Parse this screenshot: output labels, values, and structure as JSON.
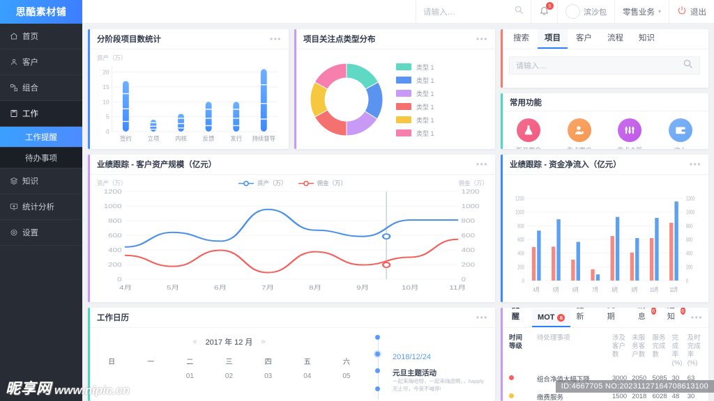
{
  "app": {
    "brand": "思酷素材铺"
  },
  "sidebar": {
    "items": [
      {
        "label": "首页",
        "icon": "home-icon"
      },
      {
        "label": "客户",
        "icon": "user-icon"
      },
      {
        "label": "组合",
        "icon": "portfolio-icon"
      },
      {
        "label": "工作",
        "icon": "briefcase-icon"
      }
    ],
    "sub_items": [
      {
        "label": "工作提醒",
        "active": true
      },
      {
        "label": "待办事项",
        "active": false
      }
    ],
    "items_after": [
      {
        "label": "知识",
        "icon": "layers-icon"
      },
      {
        "label": "统计分析",
        "icon": "monitor-icon"
      },
      {
        "label": "设置",
        "icon": "gear-icon"
      }
    ]
  },
  "topbar": {
    "search_placeholder": "请输入…",
    "notification_count": "5",
    "user_name": "滨沙包",
    "business": "零售业务",
    "logout": "退出"
  },
  "cards": {
    "stage_stats": {
      "title": "分阶段项目数统计",
      "dots": "•••",
      "accent": "#4a8cff"
    },
    "focus_types": {
      "title": "项目关注点类型分布",
      "dots": "•••",
      "accent": "#c79bf2"
    },
    "asset_scale": {
      "title": "业绩跟踪 - 客户资产规模（亿元）",
      "dots": "•••",
      "accent": "#c79bf2"
    },
    "net_inflow": {
      "title": "业绩跟踪 - 资金净流入（亿元）",
      "dots": "•••",
      "accent": "#3d8bff"
    },
    "calendar": {
      "title": "工作日历",
      "dots": "•••",
      "accent": "#4fd6c0"
    },
    "work_reminder": {
      "accent": "#c79bf2"
    }
  },
  "search_panel": {
    "accent": "#f5796f",
    "tabs": [
      {
        "label": "搜索",
        "active": false
      },
      {
        "label": "项目",
        "active": true
      },
      {
        "label": "客户",
        "active": false
      },
      {
        "label": "流程",
        "active": false
      },
      {
        "label": "知识",
        "active": false
      }
    ],
    "input_placeholder": "请输入…"
  },
  "common_funcs": {
    "title": "常用功能",
    "accent": "#4fd6c0",
    "items": [
      {
        "label": "新开客户",
        "icon": "flask-icon",
        "color": "#f2597f"
      },
      {
        "label": "重点客户",
        "icon": "star-user-icon",
        "color": "#f79851"
      },
      {
        "label": "重点个股",
        "icon": "sliders-icon",
        "color": "#c158e8"
      },
      {
        "label": "收入",
        "icon": "wallet-icon",
        "color": "#6aa7f5"
      }
    ]
  },
  "chart_data": [
    {
      "type": "bar",
      "id": "stage_stats",
      "title": "分阶段项目数统计",
      "ylabel": "资产（万）",
      "xlabel": "",
      "categories": [
        "签约",
        "立项",
        "内核",
        "反馈",
        "发行",
        "持续督导"
      ],
      "values": [
        17,
        4,
        6,
        10,
        10,
        21
      ],
      "ylim": [
        0,
        22
      ],
      "yticks": [
        0,
        5,
        10,
        15,
        20
      ],
      "grid": true,
      "color": "#3d8bff",
      "color_light": "#6fb0ff"
    },
    {
      "type": "pie",
      "id": "focus_types",
      "title": "项目关注点类型分布",
      "donut": true,
      "legend_position": "right",
      "labels": [
        "类型 1",
        "类型 1",
        "类型 1",
        "类型 1",
        "类型 1",
        "类型 1"
      ],
      "values": [
        17,
        17,
        16,
        17,
        16,
        17
      ],
      "colors": [
        "#5fd8c4",
        "#5b94f0",
        "#c89af5",
        "#f5716f",
        "#f7c740",
        "#f77fae"
      ]
    },
    {
      "type": "line",
      "id": "asset_scale",
      "title": "业绩跟踪 - 客户资产规模（亿元）",
      "ylabel": "资产（万）",
      "y2label": "佣金（万）",
      "x": [
        "4月",
        "5月",
        "6月",
        "7月",
        "8月",
        "9月",
        "10月",
        "11月"
      ],
      "ylim": [
        0,
        1200
      ],
      "yticks": [
        0,
        200,
        400,
        600,
        800,
        1000,
        1200
      ],
      "grid": true,
      "marker_x": "9月",
      "series": [
        {
          "name": "资产（万）",
          "color": "#4a90e8",
          "values": [
            440,
            640,
            520,
            955,
            670,
            585,
            810,
            810
          ]
        },
        {
          "name": "佣金（万）",
          "color": "#f5605c",
          "values": [
            325,
            175,
            395,
            90,
            375,
            195,
            300,
            545
          ]
        }
      ]
    },
    {
      "type": "bar",
      "id": "net_inflow",
      "title": "业绩跟踪 - 资金净流入（亿元）",
      "categories": [
        "4月",
        "5月",
        "6月",
        "7月",
        "8月",
        "9月",
        "10月",
        "11月"
      ],
      "ylim": [
        0,
        1200
      ],
      "yticks": [
        0,
        200,
        400,
        600,
        800,
        1000,
        1200
      ],
      "grid": true,
      "series": [
        {
          "name": "红",
          "color": "#f58a85",
          "values": [
            490,
            495,
            305,
            165,
            650,
            410,
            620,
            845
          ]
        },
        {
          "name": "蓝",
          "color": "#5ca0ef",
          "values": [
            730,
            895,
            565,
            90,
            930,
            620,
            915,
            1155
          ]
        }
      ]
    }
  ],
  "calendar": {
    "prev": "«",
    "next": "»",
    "month_label": "2017 年 12 月",
    "weekdays": [
      "日",
      "一",
      "二",
      "三",
      "四",
      "五",
      "六"
    ],
    "days": [
      "",
      "",
      "",
      "",
      "",
      "",
      ""
    ],
    "days_row2": [
      "",
      "",
      "01",
      "02",
      "03",
      "04",
      "05"
    ],
    "timeline": {
      "date": "2018/12/24",
      "event_title": "元旦主题活动",
      "event_desc": "一起来嗨哈呀，一起来嗨皮啊，，happly 无止尽，今夜不喊停!"
    }
  },
  "work_reminder": {
    "tabs": [
      {
        "label": "工作提醒",
        "count": null,
        "active": false,
        "is_title": true
      },
      {
        "label": "MOT",
        "count": "6",
        "active": true
      },
      {
        "label": "资料更新",
        "count": "6",
        "active": false
      },
      {
        "label": "合同到期",
        "count": "6",
        "active": false
      },
      {
        "label": "消息",
        "count": "6",
        "active": false
      },
      {
        "label": "通知",
        "count": "6",
        "active": false
      }
    ],
    "dots": "•••",
    "columns": [
      "时间等级",
      "待处理事项",
      "涉及客户数",
      "未服务客户数",
      "服务完成数",
      "完成率(%)",
      "及时完成率(%)"
    ],
    "rows": [
      {
        "severity_color": "#f5605c",
        "item": "组合净值大幅下降",
        "involved": "3000",
        "unserved": "2050",
        "done": "5085",
        "rate": "30",
        "ontime": "63"
      },
      {
        "severity_color": "#f7c740",
        "item": "缴费服务",
        "involved": "1500",
        "unserved": "2018",
        "done": "6028",
        "rate": "48",
        "ontime": "30"
      }
    ]
  },
  "overlay": {
    "id_text": "ID:4667705 NO:20231127164708613100",
    "watermark_cn": "昵享网",
    "watermark_url": "www.nipic.cn"
  }
}
